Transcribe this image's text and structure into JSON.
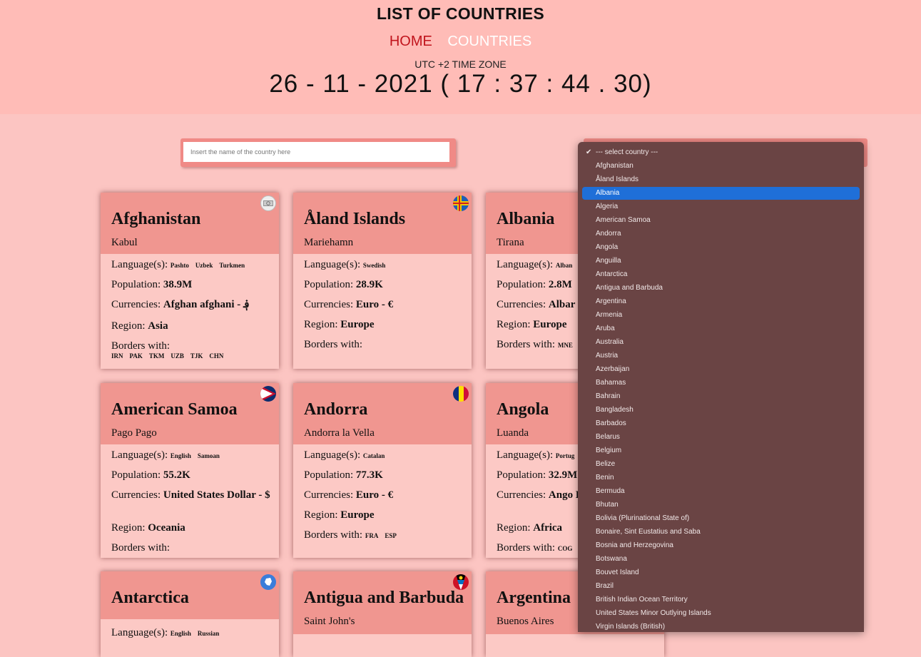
{
  "header": {
    "title": "LIST OF COUNTRIES",
    "nav": {
      "home": "HOME",
      "countries": "COUNTRIES"
    },
    "timezone": "UTC +2 TIME ZONE",
    "clock": "26 - 11 - 2021 ( 17 : 37 : 44 . 30)"
  },
  "search": {
    "placeholder": "Insert the name of the country here"
  },
  "select": {
    "highlighted": "Albania",
    "options": [
      "--- select country ---",
      "Afghanistan",
      "Åland Islands",
      "Albania",
      "Algeria",
      "American Samoa",
      "Andorra",
      "Angola",
      "Anguilla",
      "Antarctica",
      "Antigua and Barbuda",
      "Argentina",
      "Armenia",
      "Aruba",
      "Australia",
      "Austria",
      "Azerbaijan",
      "Bahamas",
      "Bahrain",
      "Bangladesh",
      "Barbados",
      "Belarus",
      "Belgium",
      "Belize",
      "Benin",
      "Bermuda",
      "Bhutan",
      "Bolivia (Plurinational State of)",
      "Bonaire, Sint Eustatius and Saba",
      "Bosnia and Herzegovina",
      "Botswana",
      "Bouvet Island",
      "Brazil",
      "British Indian Ocean Territory",
      "United States Minor Outlying Islands",
      "Virgin Islands (British)"
    ]
  },
  "labels": {
    "languages": "Language(s):",
    "population": "Population:",
    "currencies": "Currencies:",
    "region": "Region:",
    "borders": "Borders with:"
  },
  "cards": [
    {
      "name": "Afghanistan",
      "capital": "Kabul",
      "flag": "afghanistan-flag-icon",
      "languages": [
        "Pashto",
        "Uzbek",
        "Turkmen"
      ],
      "population": "38.9M",
      "currency": "Afghan afghani - ؋",
      "region": "Asia",
      "borders": [
        "IRN",
        "PAK",
        "TKM",
        "UZB",
        "TJK",
        "CHN"
      ]
    },
    {
      "name": "Åland Islands",
      "capital": "Mariehamn",
      "flag": "aland-islands-flag-icon",
      "languages": [
        "Swedish"
      ],
      "population": "28.9K",
      "currency": "Euro - €",
      "region": "Europe",
      "borders": []
    },
    {
      "name": "Albania",
      "capital": "Tirana",
      "flag": "albania-flag-icon",
      "languages": [
        "Alban"
      ],
      "population": "2.8M",
      "currency": "Albar",
      "region": "Europe",
      "borders": [
        "MNE"
      ]
    },
    {
      "name": "American Samoa",
      "capital": "Pago Pago",
      "flag": "american-samoa-flag-icon",
      "languages": [
        "English",
        "Samoan"
      ],
      "population": "55.2K",
      "currency": "United States Dollar - $",
      "region": "Oceania",
      "borders": []
    },
    {
      "name": "Andorra",
      "capital": "Andorra la Vella",
      "flag": "andorra-flag-icon",
      "languages": [
        "Catalan"
      ],
      "population": "77.3K",
      "currency": "Euro - €",
      "region": "Europe",
      "borders": [
        "FRA",
        "ESP"
      ]
    },
    {
      "name": "Angola",
      "capital": "Luanda",
      "flag": "angola-flag-icon",
      "languages": [
        "Portug"
      ],
      "population": "32.9M",
      "currency": "Ango Kz",
      "region": "Africa",
      "borders": [
        "COG"
      ]
    },
    {
      "name": "Antarctica",
      "capital": "",
      "flag": "antarctica-flag-icon",
      "languages": [
        "English",
        "Russian"
      ]
    },
    {
      "name": "Antigua and Barbuda",
      "capital": "Saint John's",
      "flag": "antigua-and-barbuda-flag-icon"
    },
    {
      "name": "Argentina",
      "capital": "Buenos Aires",
      "flag": "argentina-flag-icon"
    }
  ]
}
